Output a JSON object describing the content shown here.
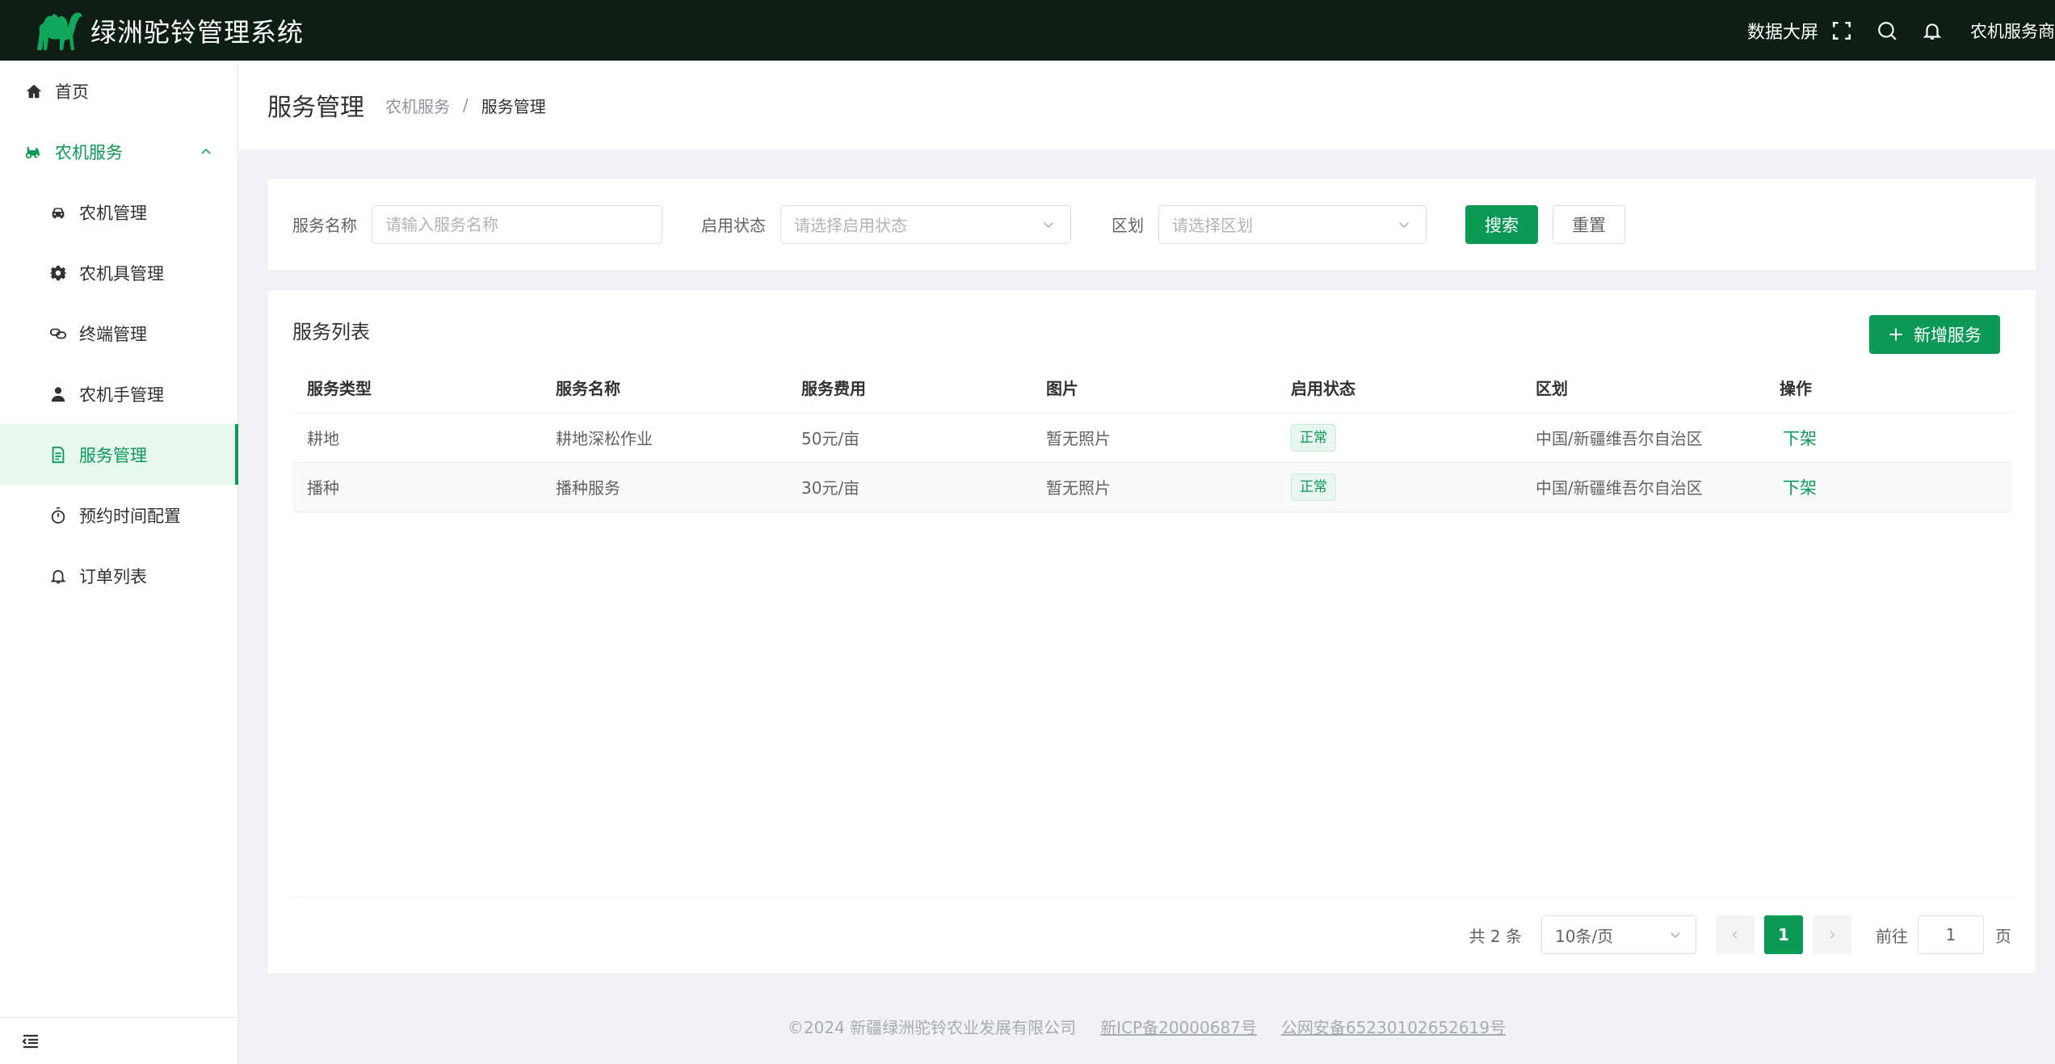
{
  "header": {
    "app_title": "绿洲驼铃管理系统",
    "data_screen": "数据大屏",
    "user": "农机服务商"
  },
  "sidebar": {
    "items": [
      {
        "label": "首页",
        "icon": "home-icon"
      },
      {
        "label": "农机服务",
        "icon": "tractor-icon"
      },
      {
        "label": "农机管理",
        "icon": "car-icon"
      },
      {
        "label": "农机具管理",
        "icon": "gear-icon"
      },
      {
        "label": "终端管理",
        "icon": "link-icon"
      },
      {
        "label": "农机手管理",
        "icon": "user-icon"
      },
      {
        "label": "服务管理",
        "icon": "document-icon"
      },
      {
        "label": "预约时间配置",
        "icon": "stopwatch-icon"
      },
      {
        "label": "订单列表",
        "icon": "bell-icon"
      }
    ],
    "active_item": "服务管理"
  },
  "page": {
    "title": "服务管理",
    "breadcrumb": [
      "农机服务",
      "服务管理"
    ],
    "breadcrumb_sep": "/"
  },
  "search": {
    "name_label": "服务名称",
    "name_placeholder": "请输入服务名称",
    "status_label": "启用状态",
    "status_placeholder": "请选择启用状态",
    "region_label": "区划",
    "region_placeholder": "请选择区划",
    "search_button": "搜索",
    "reset_button": "重置"
  },
  "list": {
    "title": "服务列表",
    "add_button": "新增服务",
    "columns": [
      "服务类型",
      "服务名称",
      "服务费用",
      "图片",
      "启用状态",
      "区划",
      "操作"
    ],
    "rows": [
      {
        "type": "耕地",
        "name": "耕地深松作业",
        "fee": "50元/亩",
        "image": "暂无照片",
        "status": "正常",
        "region": "中国/新疆维吾尔自治区",
        "action": "下架"
      },
      {
        "type": "播种",
        "name": "播种服务",
        "fee": "30元/亩",
        "image": "暂无照片",
        "status": "正常",
        "region": "中国/新疆维吾尔自治区",
        "action": "下架"
      }
    ]
  },
  "pagination": {
    "total": "共 2 条",
    "page_size": "10条/页",
    "current_page": "1",
    "goto_label": "前往",
    "goto_value": "1",
    "page_unit": "页"
  },
  "footer": {
    "copyright": "©2024 新疆绿洲驼铃农业发展有限公司",
    "icp": "新ICP备20000687号",
    "police": "公网安备65230102652619号"
  },
  "colors": {
    "primary": "#0a9a55",
    "topbar": "#0d1f14",
    "active_bg": "#e6f8ee"
  }
}
